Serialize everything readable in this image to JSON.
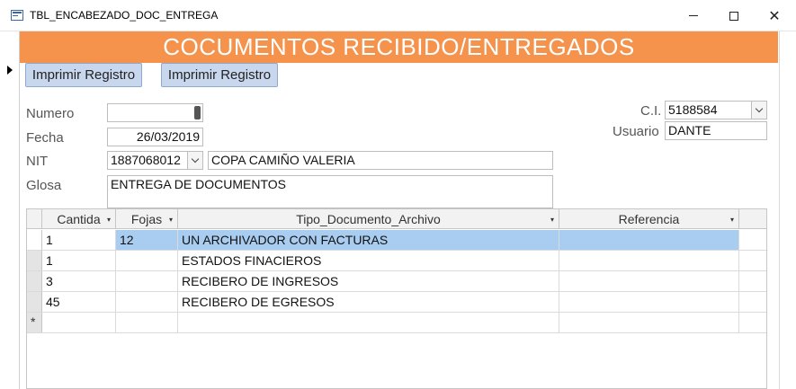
{
  "window": {
    "title": "TBL_ENCABEZADO_DOC_ENTREGA",
    "minimize_icon": "minimize-icon",
    "maximize_icon": "maximize-icon",
    "close_glyph": "✕"
  },
  "form": {
    "header_title": "COCUMENTOS RECIBIDO/ENTREGADOS",
    "header_color": "#f5934d",
    "buttons": [
      "Imprimir Registro",
      "Imprimir Registro"
    ],
    "fields": {
      "numero": {
        "label": "Numero",
        "value": ""
      },
      "fecha": {
        "label": "Fecha",
        "value": "26/03/2019"
      },
      "nit": {
        "label": "NIT",
        "value": "1887068012",
        "name_value": "COPA CAMIÑO VALERIA"
      },
      "glosa": {
        "label": "Glosa",
        "value": "ENTREGA DE DOCUMENTOS"
      },
      "ci": {
        "label": "C.I.",
        "value": "5188584"
      },
      "usuario": {
        "label": "Usuario",
        "value": "DANTE"
      }
    }
  },
  "datasheet": {
    "columns": [
      "Cantida",
      "Fojas",
      "Tipo_Documento_Archivo",
      "Referencia"
    ],
    "sort_glyph": "▾",
    "rows": [
      {
        "cantida": "1",
        "fojas": "12",
        "tipo": "UN ARCHIVADOR CON FACTURAS",
        "referencia": ""
      },
      {
        "cantida": "1",
        "fojas": "",
        "tipo": "ESTADOS FINACIEROS",
        "referencia": ""
      },
      {
        "cantida": "3",
        "fojas": "",
        "tipo": "RECIBERO DE INGRESOS",
        "referencia": ""
      },
      {
        "cantida": "45",
        "fojas": "",
        "tipo": "RECIBERO DE EGRESOS",
        "referencia": ""
      }
    ],
    "new_row_marker": "*",
    "selected_row_color": "#a9cdf0"
  }
}
